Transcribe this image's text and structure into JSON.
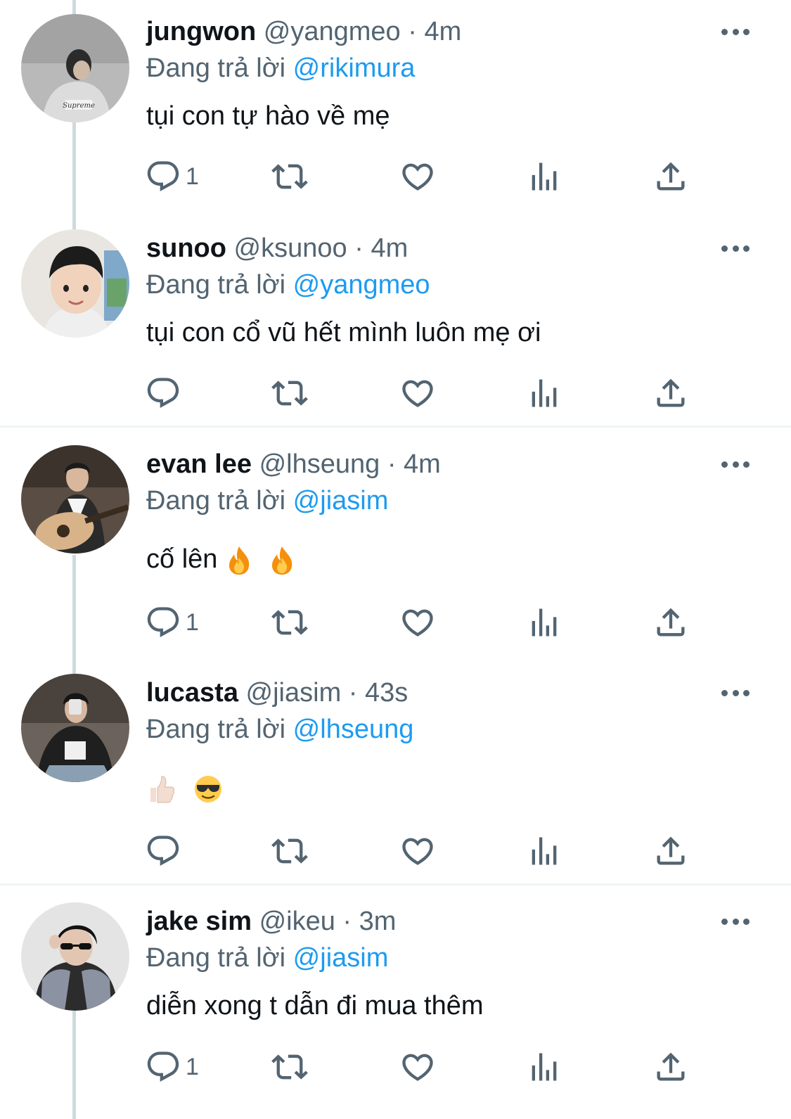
{
  "tweets": [
    {
      "display_name": "jungwon",
      "handle": "@yangmeo",
      "separator": "·",
      "time": "4m",
      "reply_prefix": "Đang trả lời",
      "reply_to": "@rikimura",
      "text": "tụi con tự hào về mẹ",
      "reply_count": "1"
    },
    {
      "display_name": "sunoo",
      "handle": "@ksunoo",
      "separator": "·",
      "time": "4m",
      "reply_prefix": "Đang trả lời",
      "reply_to": "@yangmeo",
      "text": "tụi con cổ vũ hết mình luôn mẹ ơi",
      "reply_count": ""
    },
    {
      "display_name": "evan lee",
      "handle": "@lhseung",
      "separator": "·",
      "time": "4m",
      "reply_prefix": "Đang trả lời",
      "reply_to": "@jiasim",
      "text": "cố lên",
      "emojis": [
        "fire-emoji",
        "fire-emoji"
      ],
      "reply_count": "1"
    },
    {
      "display_name": "lucasta",
      "handle": "@jiasim",
      "separator": "·",
      "time": "43s",
      "reply_prefix": "Đang trả lời",
      "reply_to": "@lhseung",
      "text": "",
      "emojis": [
        "thumbs-up-emoji",
        "sunglasses-emoji"
      ],
      "reply_count": ""
    },
    {
      "display_name": "jake sim",
      "handle": "@ikeu",
      "separator": "·",
      "time": "3m",
      "reply_prefix": "Đang trả lời",
      "reply_to": "@jiasim",
      "text": "diễn xong t dẫn đi mua thêm",
      "reply_count": "1"
    }
  ],
  "icons": {
    "reply": "reply-icon",
    "retweet": "retweet-icon",
    "like": "heart-icon",
    "views": "analytics-icon",
    "share": "share-icon",
    "more": "more-icon"
  },
  "colors": {
    "text": "#0f1419",
    "secondary": "#536471",
    "mention": "#1d9bf0",
    "thread_line": "#cfd9de",
    "divider": "#eff3f4"
  }
}
